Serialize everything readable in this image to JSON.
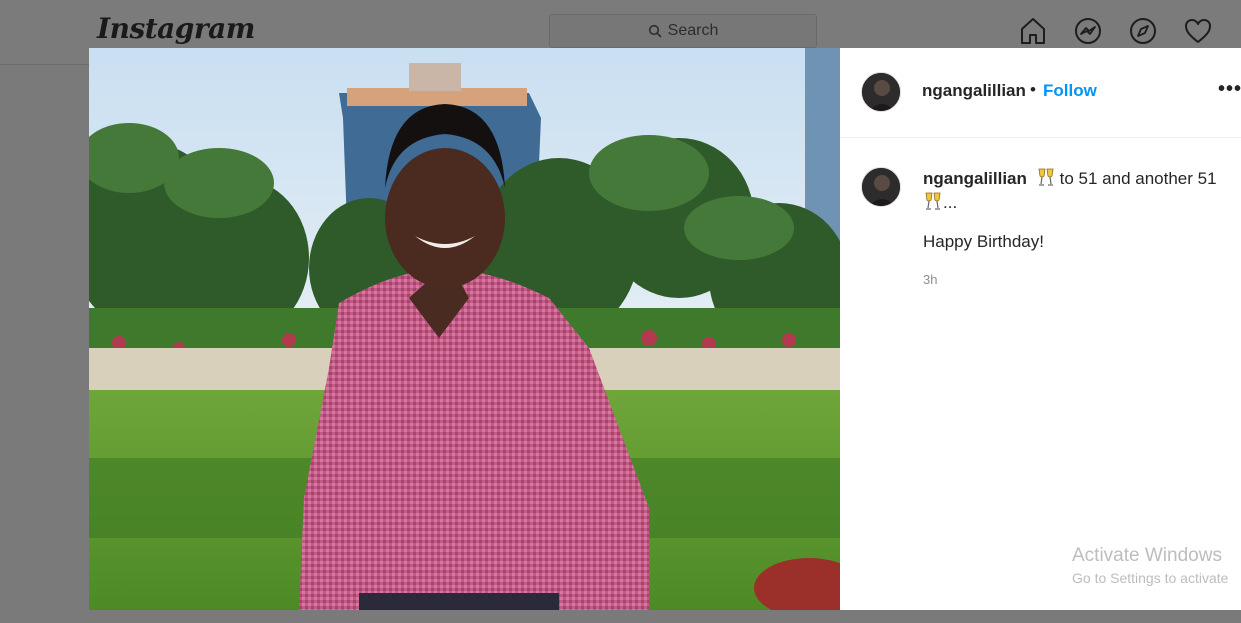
{
  "nav": {
    "logo": "Instagram",
    "search_placeholder": "Search",
    "icons": [
      "home-icon",
      "messenger-icon",
      "explore-icon",
      "activity-heart-icon"
    ]
  },
  "post": {
    "image_subject": "man in pink checked shirt standing in front of palm trees and a building",
    "header": {
      "username": "ngangalillian",
      "separator": "•",
      "follow_label": "Follow",
      "more_label": "•••"
    },
    "caption": {
      "username": "ngangalillian",
      "text": "to 51 and another 51",
      "ellipsis": "...",
      "emoji": "clinking-glasses"
    },
    "comment": "Happy Birthday!",
    "timestamp": "3h"
  },
  "watermark": {
    "title": "Activate Windows",
    "subtitle": "Go to Settings to activate"
  },
  "colors": {
    "follow": "#0095f6",
    "text": "#262626",
    "muted": "#8e8e8e",
    "overlay": "#7a7a7a"
  }
}
